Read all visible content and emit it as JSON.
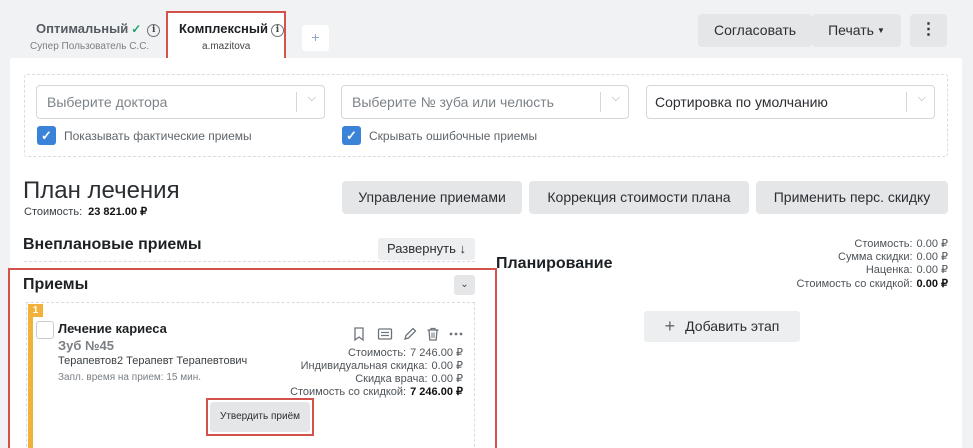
{
  "tabs": [
    {
      "title": "Оптимальный",
      "check": "✓",
      "info": "i",
      "subtitle": "Супер Пользователь С.С."
    },
    {
      "title": "Комплексный",
      "info": "i",
      "subtitle": "a.mazitova"
    }
  ],
  "tab_add_label": "+",
  "toolbar": {
    "agree_label": "Согласовать",
    "print_label": "Печать",
    "print_caret": "▼",
    "more_label": "⋮"
  },
  "filters": {
    "doctor_placeholder": "Выберите доктора",
    "tooth_placeholder": "Выберите № зуба или челюсть",
    "sort_value": "Сортировка по умолчанию",
    "show_actual_label": "Показывать фактические приемы",
    "hide_wrong_label": "Скрывать ошибочные приемы",
    "check_mark": "✓",
    "chevron": "⌵"
  },
  "plan": {
    "title": "План лечения",
    "cost_label": "Стоимость:",
    "cost_value": "23 821.00 ₽",
    "manage_label": "Управление приемами",
    "correct_label": "Коррекция стоимости плана",
    "discount_label": "Применить перс. скидку"
  },
  "unplanned": {
    "title": "Внеплановые приемы",
    "expand_label": "Развернуть ↓"
  },
  "appointments": {
    "title": "Приемы",
    "collapse_icon": "⌄",
    "item": {
      "number": "1",
      "title": "Лечение кариеса",
      "tooth": "Зуб №45",
      "doctor": "Терапевтов2 Терапевт Терапевтович",
      "time": "Запл. время на прием: 15 мин.",
      "cost_label": "Стоимость:",
      "cost_value": "7 246.00 ₽",
      "ind_discount_label": "Индивидуальная скидка:",
      "ind_discount_value": "0.00 ₽",
      "doc_discount_label": "Скидка врача:",
      "doc_discount_value": "0.00 ₽",
      "discounted_label": "Стоимость со скидкой:",
      "discounted_value": "7 246.00 ₽",
      "confirm_label": "Утвердить приём"
    }
  },
  "planning": {
    "title": "Планирование",
    "cost_label": "Стоимость:",
    "cost_value": "0.00 ₽",
    "discount_sum_label": "Сумма скидки:",
    "discount_sum_value": "0.00 ₽",
    "markup_label": "Наценка:",
    "markup_value": "0.00 ₽",
    "discounted_label": "Стоимость со скидкой:",
    "discounted_value": "0.00 ₽",
    "add_stage_plus": "+",
    "add_stage_label": "Добавить этап"
  },
  "colors": {
    "accent_blue": "#3b82d9",
    "highlight_red": "#d3534c",
    "stage_orange": "#f2b13a",
    "check_green": "#22a06b"
  }
}
